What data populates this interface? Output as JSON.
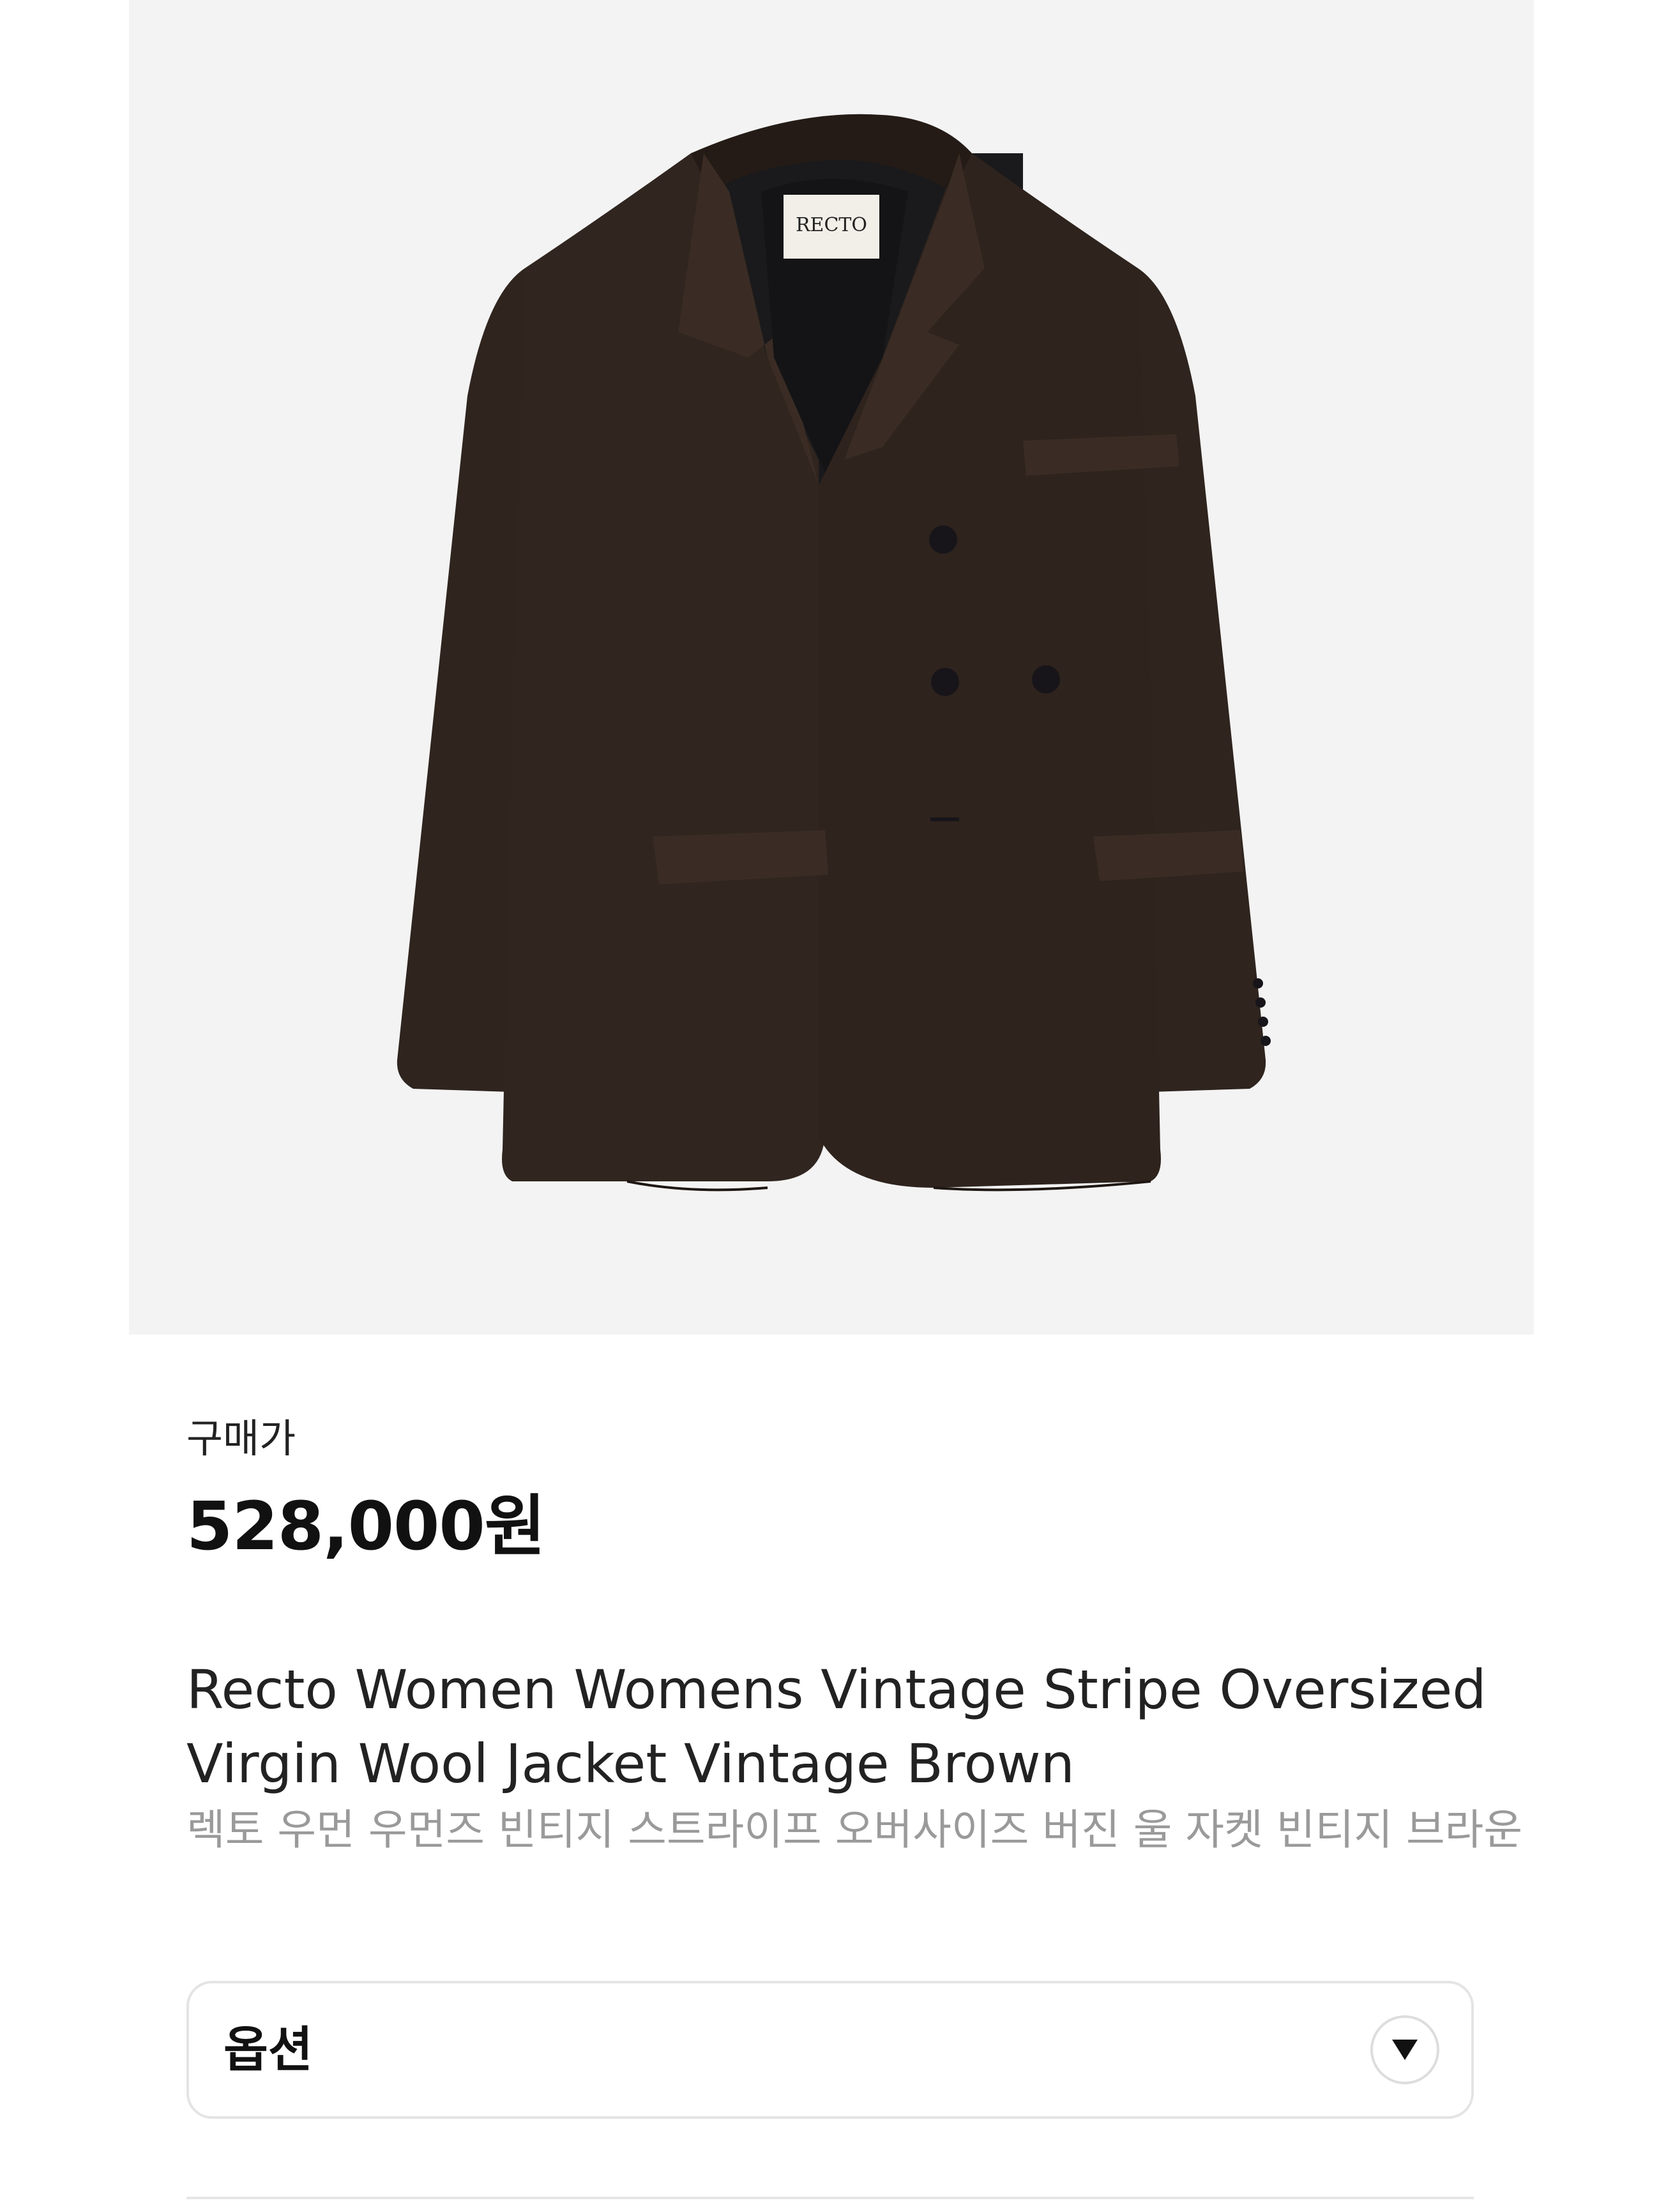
{
  "product_image": {
    "label_text": "RECTO",
    "background_color": "#f3f3f3",
    "jacket_color": "#2d221c"
  },
  "price": {
    "label": "구매가",
    "value": "528,000원"
  },
  "product": {
    "title_en": "Recto Women Womens Vintage Stripe Oversized Virgin Wool Jacket Vintage Brown",
    "title_ko": "렉토 우먼 우먼즈 빈티지 스트라이프 오버사이즈 버진 울 자켓 빈티지 브라운"
  },
  "option": {
    "label": "옵션",
    "toggle_icon": "triangle-down-icon"
  }
}
